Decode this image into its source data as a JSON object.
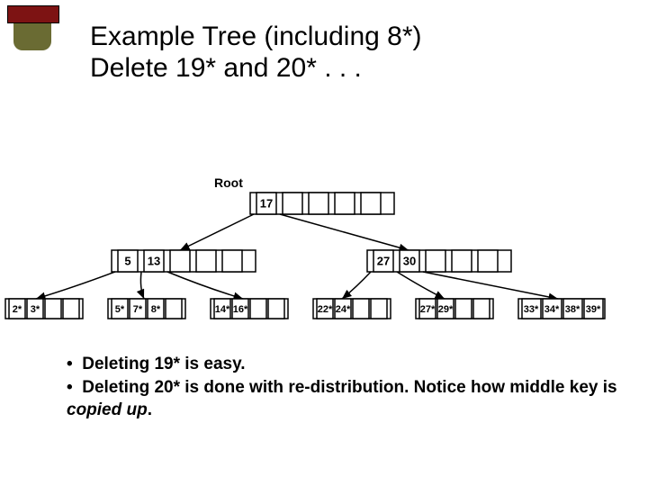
{
  "title_l1": "Example Tree (including 8*)",
  "title_l2": "Delete 19* and 20* . . .",
  "root_label": "Root",
  "root_keys": [
    "17",
    "",
    "",
    "",
    ""
  ],
  "inner_left": [
    "5",
    "13",
    "",
    "",
    ""
  ],
  "inner_right": [
    "27",
    "30",
    "",
    "",
    ""
  ],
  "leaves": [
    [
      "2*",
      "3*",
      "",
      ""
    ],
    [
      "5*",
      "7*",
      "8*",
      ""
    ],
    [
      "14*",
      "16*",
      "",
      ""
    ],
    [
      "22*",
      "24*",
      "",
      ""
    ],
    [
      "27*",
      "29*",
      "",
      ""
    ],
    [
      "33*",
      "34*",
      "38*",
      "39*"
    ]
  ],
  "bullet1": "Deleting 19* is easy.",
  "bullet2a": "Deleting 20* is done with re-distribution. Notice how middle key is ",
  "bullet2b": "copied up",
  "bullet2c": "."
}
